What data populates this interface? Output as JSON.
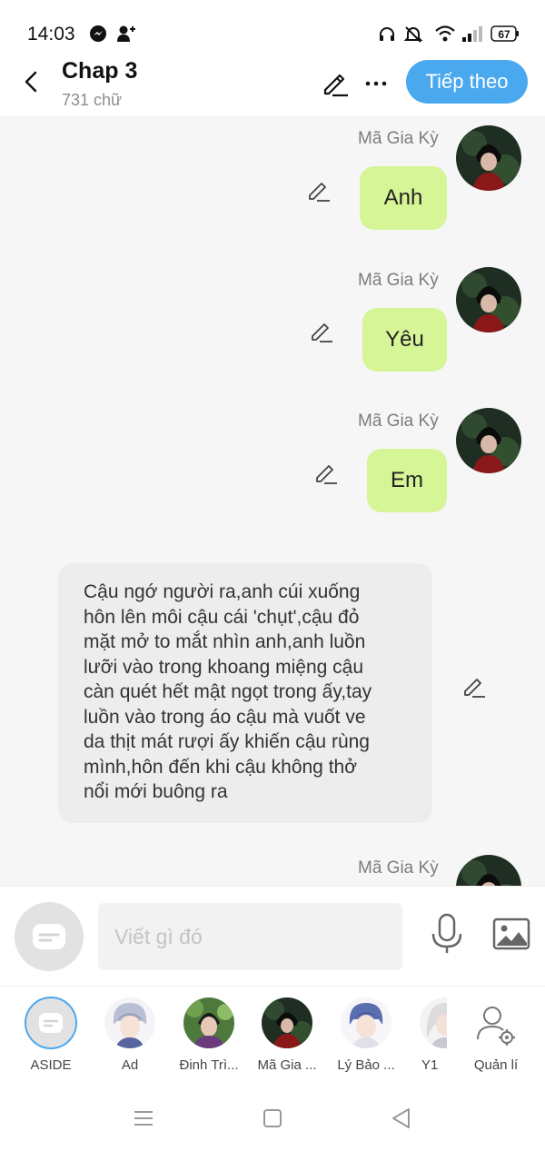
{
  "status_bar": {
    "time": "14:03",
    "battery": "67"
  },
  "header": {
    "title": "Chap 3",
    "subtitle": "731 chữ",
    "next_label": "Tiếp theo"
  },
  "messages": [
    {
      "name": "Mã Gia Kỳ",
      "text": "Anh"
    },
    {
      "name": "Mã Gia Kỳ",
      "text": "Yêu"
    },
    {
      "name": "Mã Gia Kỳ",
      "text": "Em"
    }
  ],
  "narration": {
    "lines": [
      "Cậu ngớ người ra,anh cúi xuống",
      "hôn lên môi cậu cái 'chụt',cậu đỏ",
      "mặt mở to mắt nhìn anh,anh luồn",
      "lưỡi vào trong khoang miệng cậu",
      "càn quét hết mật ngọt trong ấy,tay",
      "luồn vào trong áo cậu mà vuốt ve",
      "da thịt mát rượi ấy khiến cậu rùng",
      "mình,hôn đến khi cậu không thở",
      "nổi mới buông ra"
    ]
  },
  "partial_message": {
    "name": "Mã Gia Kỳ"
  },
  "composer": {
    "placeholder": "Viết gì đó"
  },
  "characters": [
    {
      "label": "ASIDE",
      "icon": "chat-bubble-icon"
    },
    {
      "label": "Ad",
      "icon": "avatar-anime-silver-hair"
    },
    {
      "label": "Đinh Trì...",
      "icon": "avatar-photo-green"
    },
    {
      "label": "Mã Gia ...",
      "icon": "avatar-photo-dark"
    },
    {
      "label": "Lý Bảo ...",
      "icon": "avatar-anime-blue-hair"
    },
    {
      "label": "Y1",
      "icon": "avatar-anime-white-hair"
    },
    {
      "label": "Quản lí",
      "icon": "user-gear-icon"
    }
  ],
  "colors": {
    "accent": "#4aa8ee",
    "bubble": "#d6f596",
    "narration_bg": "#ededed",
    "page_bg": "#f6f6f6"
  }
}
